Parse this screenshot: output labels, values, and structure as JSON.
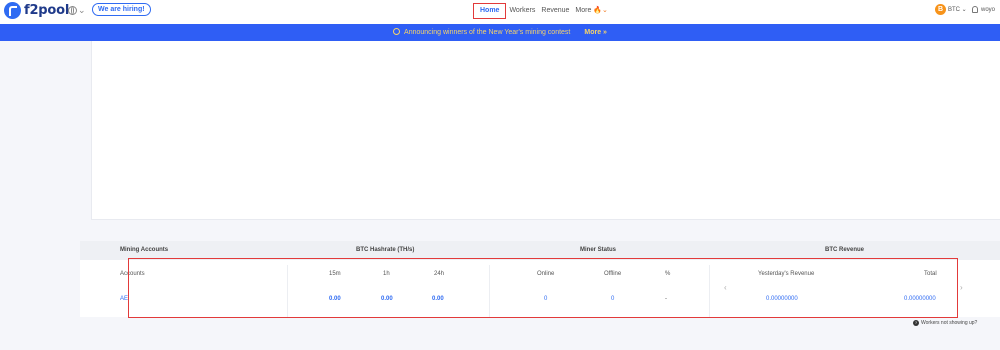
{
  "header": {
    "logo_text": "f2pool",
    "language_caret": "⌄",
    "hiring_label": "We are hiring!",
    "nav": [
      {
        "label": "Home"
      },
      {
        "label": "Workers"
      },
      {
        "label": "Revenue"
      },
      {
        "label": "More"
      }
    ],
    "nav_more_icon": "🔥⌄",
    "coin_badge": "B",
    "coin_label": "BTC ⌄",
    "user_label": "woyo"
  },
  "banner": {
    "text": "Announcing winners of the New Year's mining contest",
    "more_label": "More »"
  },
  "table": {
    "group_headers": {
      "accounts": "Mining Accounts",
      "hashrate": "BTC Hashrate (TH/s)",
      "status": "Miner Status",
      "revenue": "BTC Revenue"
    },
    "columns": {
      "accounts": "Accounts",
      "m15": "15m",
      "h1": "1h",
      "h24": "24h",
      "online": "Online",
      "offline": "Offline",
      "percent": "%",
      "yesterday": "Yesterday's Revenue",
      "total": "Total"
    },
    "row": {
      "account": "AE",
      "m15": "0.00",
      "h1": "0.00",
      "h24": "0.00",
      "online": "0",
      "offline": "0",
      "percent": "-",
      "yesterday": "0.00000000",
      "total": "0.00000000"
    },
    "prev_arrow": "‹",
    "next_arrow": "›"
  },
  "help_text": "Workers not showing up?",
  "colors": {
    "accent": "#2f6bf2",
    "banner": "#2f5ef5",
    "banner_text": "#f4d36b",
    "highlight": "#e23a3a"
  }
}
